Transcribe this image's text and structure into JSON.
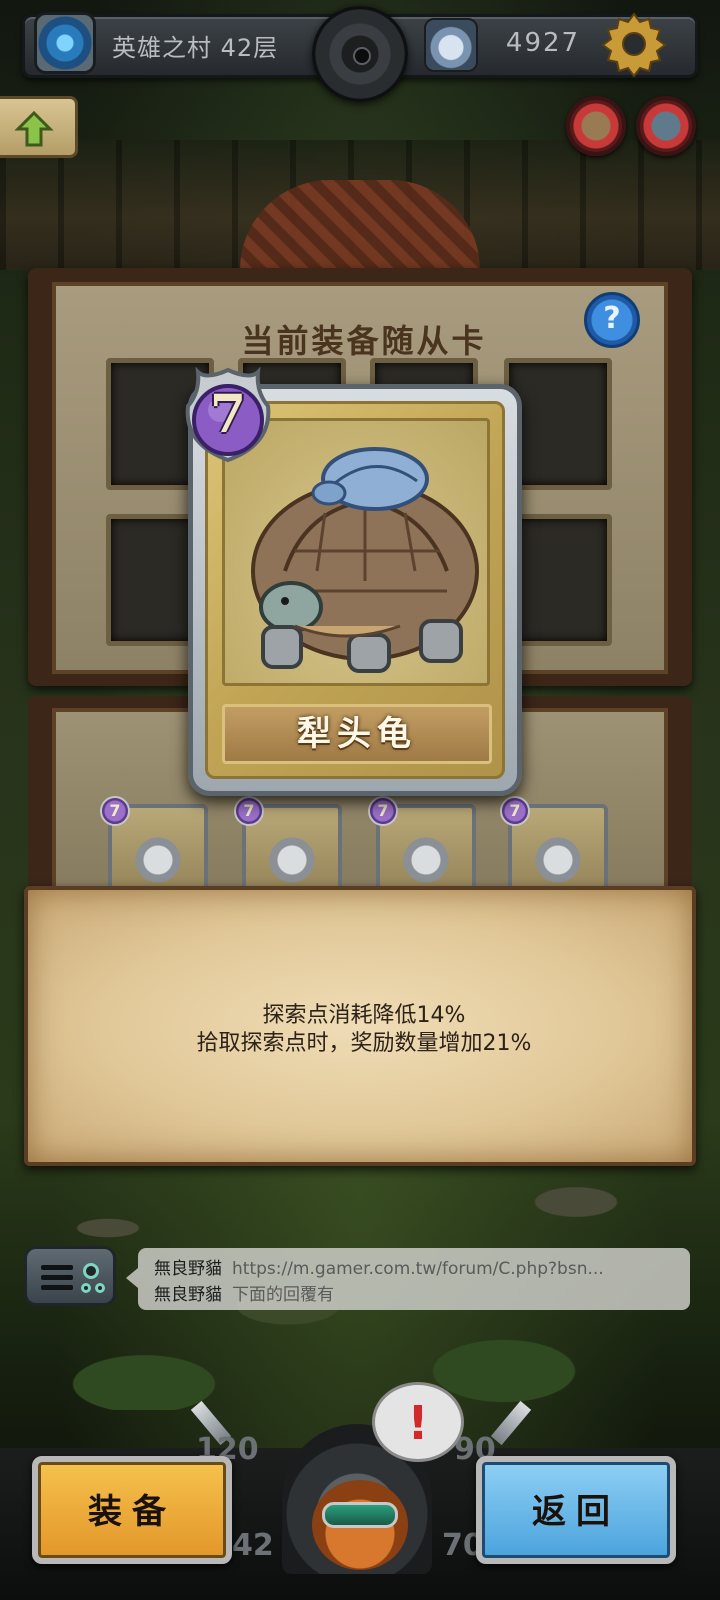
{
  "topbar": {
    "floor_label": "英雄之村 42层",
    "score": "4927",
    "icons": {
      "portal": "portal-icon",
      "center": "gear-wheel-icon",
      "helmet": "helmet-icon",
      "settings": "settings-gear-icon"
    }
  },
  "side_buttons": {
    "up": "up-arrow-icon",
    "food": "food-icon",
    "pet": "pet-icon"
  },
  "equip_panel": {
    "title": "当前装备随从卡",
    "help": "?"
  },
  "card": {
    "cost": "7",
    "name": "犁头龟"
  },
  "card_list": {
    "costs": [
      "7",
      "7",
      "7",
      "7"
    ]
  },
  "description": {
    "line1": "探索点消耗降低14%",
    "line2": "拾取探索点时，奖励数量增加21%"
  },
  "chat": {
    "messages": [
      {
        "user": "無良野貓",
        "text": "https://m.gamer.com.tw/forum/C.php?bsn..."
      },
      {
        "user": "無良野貓",
        "text": "下面的回覆有"
      }
    ]
  },
  "bottom": {
    "equip_label": "装备",
    "back_label": "返回",
    "alert": "!",
    "stats": {
      "top_left": "120",
      "top_right": "90",
      "bottom_left": "42",
      "bottom_right": "70"
    }
  },
  "colors": {
    "equip_button": "#f6c24e",
    "back_button": "#8fd0f4",
    "cost_badge": "#8b5cc4",
    "parchment": "#e1c898"
  }
}
